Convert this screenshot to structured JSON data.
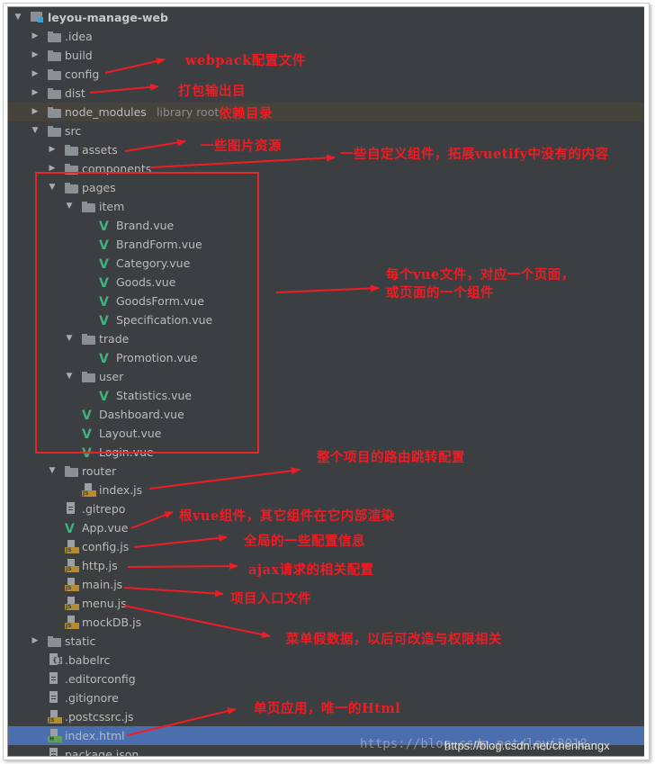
{
  "tree": [
    {
      "label": "leyou-manage-web",
      "type": "project",
      "depth": 0,
      "arrow": "expanded",
      "bold": true
    },
    {
      "label": ".idea",
      "type": "folder",
      "depth": 1,
      "arrow": "collapsed"
    },
    {
      "label": "build",
      "type": "folder",
      "depth": 1,
      "arrow": "collapsed"
    },
    {
      "label": "config",
      "type": "folder",
      "depth": 1,
      "arrow": "collapsed"
    },
    {
      "label": "dist",
      "type": "folder",
      "depth": 1,
      "arrow": "collapsed"
    },
    {
      "label": "node_modules",
      "extra": "library root",
      "type": "folder",
      "depth": 1,
      "arrow": "collapsed",
      "highlight": "library"
    },
    {
      "label": "src",
      "type": "folder",
      "depth": 1,
      "arrow": "expanded"
    },
    {
      "label": "assets",
      "type": "folder",
      "depth": 2,
      "arrow": "collapsed"
    },
    {
      "label": "components",
      "type": "folder",
      "depth": 2,
      "arrow": "collapsed"
    },
    {
      "label": "pages",
      "type": "folder",
      "depth": 2,
      "arrow": "expanded"
    },
    {
      "label": "item",
      "type": "folder",
      "depth": 3,
      "arrow": "expanded"
    },
    {
      "label": "Brand.vue",
      "type": "vue",
      "depth": 4
    },
    {
      "label": "BrandForm.vue",
      "type": "vue",
      "depth": 4
    },
    {
      "label": "Category.vue",
      "type": "vue",
      "depth": 4
    },
    {
      "label": "Goods.vue",
      "type": "vue",
      "depth": 4
    },
    {
      "label": "GoodsForm.vue",
      "type": "vue",
      "depth": 4
    },
    {
      "label": "Specification.vue",
      "type": "vue",
      "depth": 4
    },
    {
      "label": "trade",
      "type": "folder",
      "depth": 3,
      "arrow": "expanded"
    },
    {
      "label": "Promotion.vue",
      "type": "vue",
      "depth": 4
    },
    {
      "label": "user",
      "type": "folder",
      "depth": 3,
      "arrow": "expanded"
    },
    {
      "label": "Statistics.vue",
      "type": "vue",
      "depth": 4
    },
    {
      "label": "Dashboard.vue",
      "type": "vue",
      "depth": 3
    },
    {
      "label": "Layout.vue",
      "type": "vue",
      "depth": 3
    },
    {
      "label": "Login.vue",
      "type": "vue",
      "depth": 3
    },
    {
      "label": "router",
      "type": "folder",
      "depth": 2,
      "arrow": "expanded"
    },
    {
      "label": "index.js",
      "type": "js",
      "depth": 3
    },
    {
      "label": ".gitrepo",
      "type": "text",
      "depth": 2
    },
    {
      "label": "App.vue",
      "type": "vue",
      "depth": 2
    },
    {
      "label": "config.js",
      "type": "js",
      "depth": 2
    },
    {
      "label": "http.js",
      "type": "js",
      "depth": 2
    },
    {
      "label": "main.js",
      "type": "js",
      "depth": 2
    },
    {
      "label": "menu.js",
      "type": "js",
      "depth": 2
    },
    {
      "label": "mockDB.js",
      "type": "js",
      "depth": 2
    },
    {
      "label": "static",
      "type": "folder",
      "depth": 1,
      "arrow": "collapsed"
    },
    {
      "label": ".babelrc",
      "type": "babel",
      "depth": 1
    },
    {
      "label": ".editorconfig",
      "type": "text",
      "depth": 1
    },
    {
      "label": ".gitignore",
      "type": "text",
      "depth": 1
    },
    {
      "label": ".postcssrc.js",
      "type": "js",
      "depth": 1
    },
    {
      "label": "index.html",
      "type": "html",
      "depth": 1,
      "highlight": "selected"
    },
    {
      "label": "package.json",
      "type": "text",
      "depth": 1
    }
  ],
  "annotations": {
    "config": "webpack配置文件",
    "dist": "打包输出目",
    "node_modules": "依赖目录",
    "assets": "一些图片资源",
    "components": "一些自定义组件，拓展vuetify中没有的内容",
    "pages_line1": "每个vue文件，对应一个页面，",
    "pages_line2": "或页面的一个组件",
    "router": "整个项目的路由跳转配置",
    "app_vue": "根vue组件，其它组件在它内部渲染",
    "config_js": "全局的一些配置信息",
    "http_js": "ajax请求的相关配置",
    "main_js": "项目入口文件",
    "menu_js": "菜单假数据，以后可改造与权限相关",
    "index_html": "单页应用，唯一的Html"
  },
  "colors": {
    "panel_bg": "#3c3f41",
    "selection": "#4b6eaf",
    "annotation_red": "#ef1c24",
    "vue_green": "#3fb27f"
  },
  "watermark": {
    "ghost": "https://blog.csdn.net/leyi2018",
    "real": "https://blog.csdn.net/chenhangx"
  }
}
